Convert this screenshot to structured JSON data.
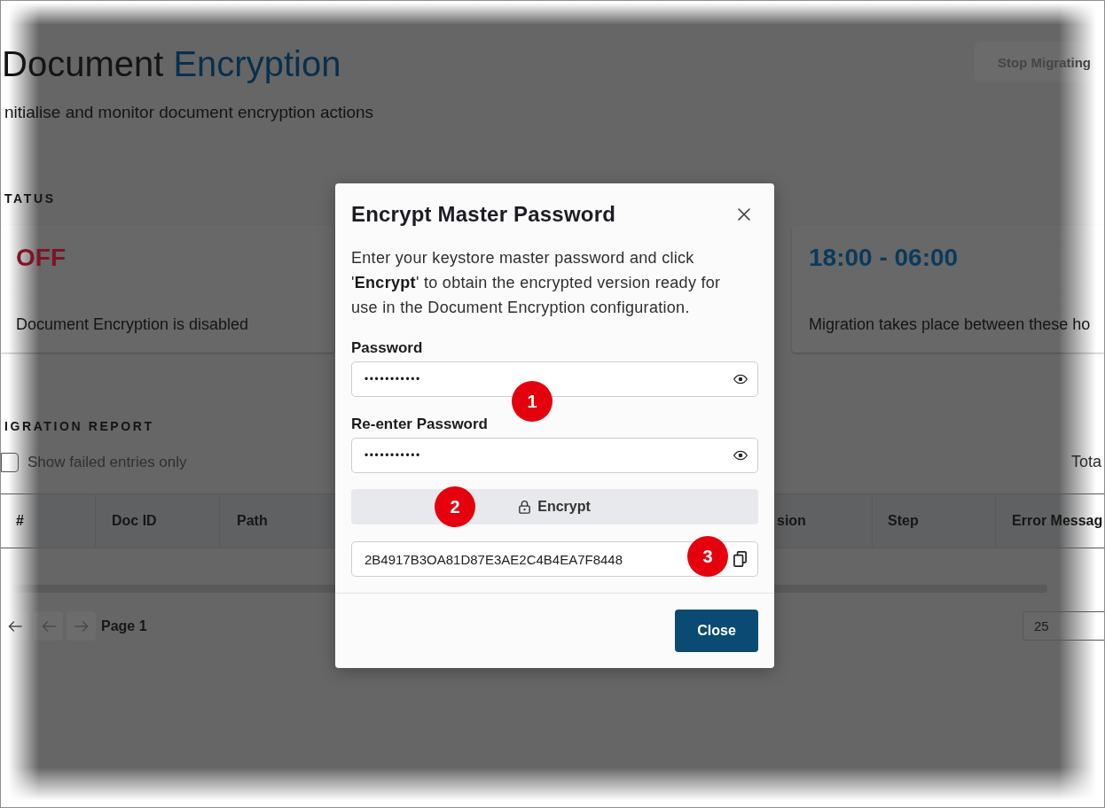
{
  "page": {
    "title": {
      "lead": "Document",
      "accent": "Encryption"
    },
    "subtitle": "nitialise and monitor document encryption actions",
    "stop_button": {
      "label": "Stop Migrating",
      "disabled": true
    },
    "status": {
      "heading": "TATUS",
      "cards": [
        {
          "value": "OFF",
          "color": "#7e1426",
          "caption": "Document Encryption is disabled"
        },
        {
          "value": "18:00 - 06:00",
          "color": "#0a3a5c",
          "caption": "Migration takes place between these ho"
        }
      ]
    },
    "report": {
      "heading": "IGRATION REPORT",
      "filter": {
        "label": "Show failed entries only",
        "checked": false
      },
      "total": "Tota",
      "table": {
        "columns": [
          "#",
          "Doc ID",
          "Path",
          "sion",
          "Step",
          "Error Messag"
        ]
      },
      "pagination": {
        "page": "Page 1",
        "page_size": "25"
      }
    }
  },
  "dialog": {
    "title": "Encrypt Master Password",
    "description": "Enter your keystore master password and click '**Encrypt**' to obtain the encrypted version ready for use in the Document Encryption configuration.",
    "fields": [
      {
        "label": "Password",
        "value": "•••••••••••"
      },
      {
        "label": "Re-enter Password",
        "value": "•••••••••••"
      }
    ],
    "encrypt_button": "Encrypt",
    "result": "2B4917B3OA81D87E3AE2C4B4EA7F8448",
    "close_button": "Close"
  },
  "callouts": [
    "1",
    "2",
    "3"
  ]
}
